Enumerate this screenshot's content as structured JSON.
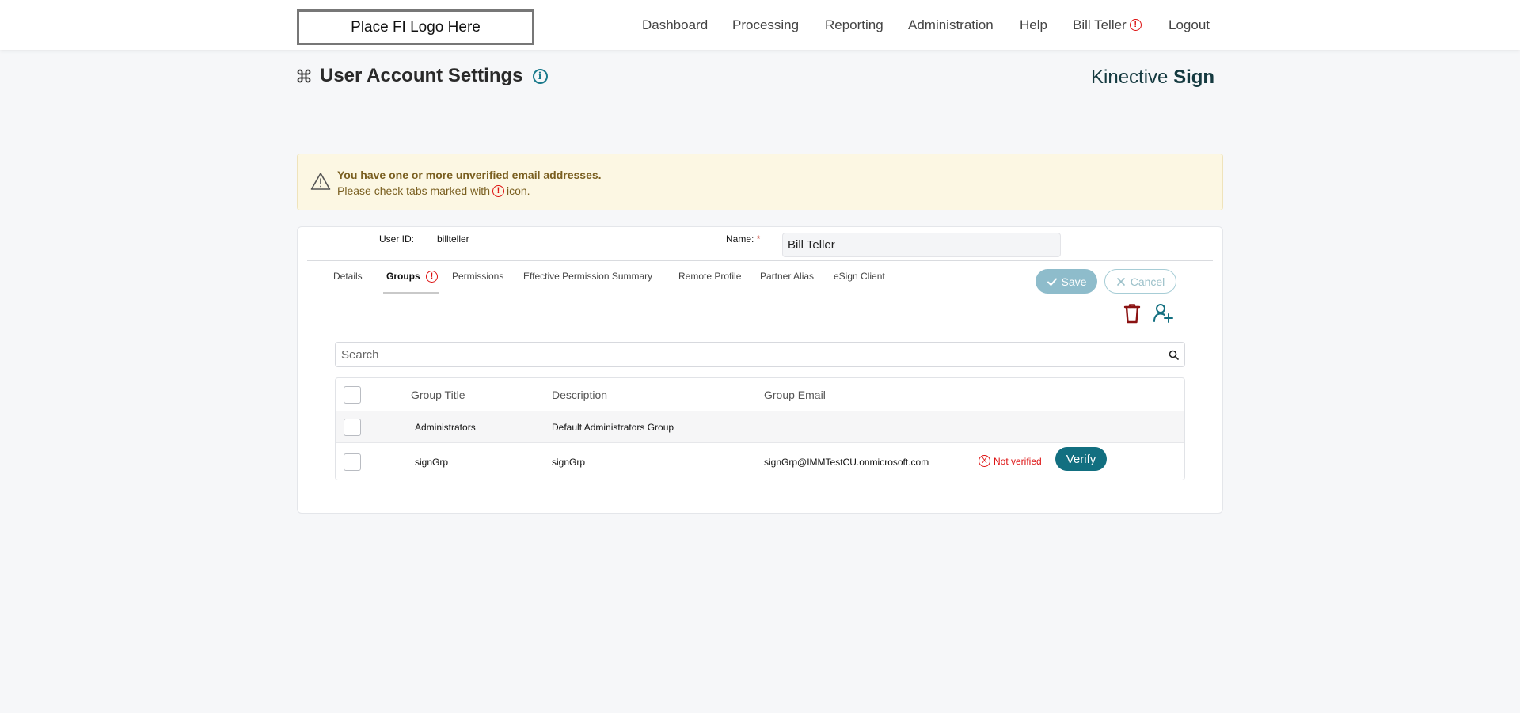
{
  "header": {
    "logo_text": "Place FI Logo Here",
    "nav": [
      {
        "label": "Dashboard"
      },
      {
        "label": "Processing"
      },
      {
        "label": "Reporting"
      },
      {
        "label": "Administration"
      },
      {
        "label": "Help"
      },
      {
        "label": "Bill Teller"
      },
      {
        "label": "Logout"
      }
    ],
    "alert_glyph": "!"
  },
  "page": {
    "title": "User Account Settings",
    "title_icon": "command-icon",
    "info_glyph": "i",
    "brand_light": "Kinective",
    "brand_bold": "Sign"
  },
  "warning": {
    "title": "You have one or more unverified email addresses.",
    "prefix": "Please check tabs marked with",
    "suffix": "icon.",
    "alert_glyph": "!"
  },
  "form": {
    "user_id_label": "User ID:",
    "user_id_value": "billteller",
    "name_label": "Name:",
    "required_mark": "*",
    "name_value": "Bill Teller"
  },
  "tabs": [
    {
      "label": "Details",
      "active": false
    },
    {
      "label": "Groups",
      "active": true,
      "alert": true
    },
    {
      "label": "Permissions",
      "active": false
    },
    {
      "label": "Effective Permission Summary",
      "active": false
    },
    {
      "label": "Remote Profile",
      "active": false
    },
    {
      "label": "Partner Alias",
      "active": false
    },
    {
      "label": "eSign Client",
      "active": false
    }
  ],
  "actions": {
    "save_label": "Save",
    "cancel_label": "Cancel"
  },
  "search": {
    "placeholder": "Search"
  },
  "table": {
    "headers": [
      "Group Title",
      "Description",
      "Group Email"
    ],
    "rows": [
      {
        "title": "Administrators",
        "description": "Default Administrators Group",
        "email": "",
        "status": "",
        "action": ""
      },
      {
        "title": "signGrp",
        "description": "signGrp",
        "email": "signGrp@IMMTestCU.onmicrosoft.com",
        "status": "Not verified",
        "action": "Verify"
      }
    ],
    "status_glyph": "X"
  },
  "colors": {
    "accent": "#126f80",
    "danger": "#dd1111",
    "warning_bg": "#fcf7e3"
  }
}
